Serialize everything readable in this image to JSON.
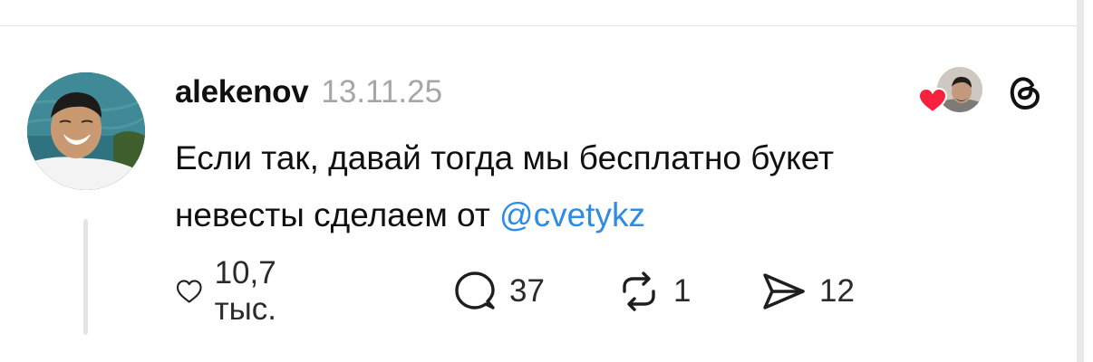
{
  "post": {
    "username": "alekenov",
    "date": "13.11.25",
    "text_line1": "Если так, давай тогда мы бесплатно букет",
    "text_line2_prefix": "невесты сделаем от ",
    "mention": "@cvetykz"
  },
  "actions": {
    "likes": "10,7 тыс.",
    "comments": "37",
    "reposts": "1",
    "shares": "12"
  },
  "colors": {
    "mention": "#2d8ce6",
    "heart": "#f5213f",
    "text": "#101010",
    "muted": "#a6a6a6"
  },
  "icons": [
    "heart-icon",
    "comment-icon",
    "repost-icon",
    "share-icon",
    "threads-logo-icon"
  ]
}
